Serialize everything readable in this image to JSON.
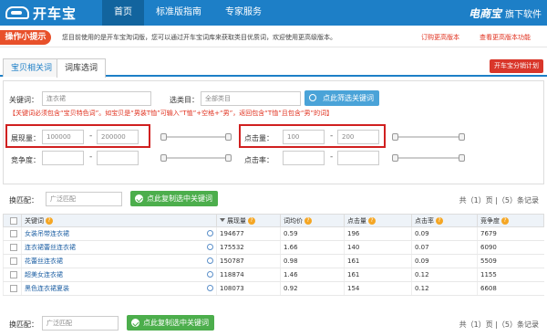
{
  "header": {
    "logo_text": "开车宝",
    "nav": [
      "首页",
      "标准版指南",
      "专家服务"
    ],
    "brand_name": "电商宝",
    "brand_suffix": "旗下软件"
  },
  "notice": {
    "badge": "操作小提示",
    "text": "您目前使用的是开车宝淘词版，您可以通过开车宝词库来获取类目优质词，欢迎使用更高级版本。",
    "link1": "订购更高版本",
    "link2": "查看更高版本功能"
  },
  "tabs": [
    "宝贝相关词",
    "词库选词"
  ],
  "plan_button": "开车宝分销计划",
  "filters": {
    "keyword_label": "关键词：",
    "keyword_value": "连衣裙",
    "category_label": "选类目：",
    "category_value": "全部类目",
    "search_button": "点此筛选关键词",
    "hint": "【关键词必须包含“宝贝特色词”。如宝贝是“男装T恤”可输入“T恤”+空格+“男”，返回包含“T恤”且包含“男”的词】",
    "impressions_label": "展现量：",
    "impressions_min": "100000",
    "impressions_max": "200000",
    "clicks_label": "点击量：",
    "clicks_min": "100",
    "clicks_max": "200",
    "competition_label": "竞争度：",
    "ctr_label": "点击率：",
    "dash": "-"
  },
  "match": {
    "label": "换匹配：",
    "value": "广泛匹配",
    "copy_button": "点此复制选中关键词",
    "pager": "共（1）页 |（5）条记录"
  },
  "table": {
    "columns": [
      "关键词",
      "展现量",
      "词均价",
      "点击量",
      "点击率",
      "竞争度"
    ],
    "rows": [
      [
        "女装吊带连衣裙",
        "194677",
        "0.59",
        "196",
        "0.09",
        "7679"
      ],
      [
        "连衣裙蕾丝连衣裙",
        "175532",
        "1.66",
        "140",
        "0.07",
        "6090"
      ],
      [
        "花蕾丝连衣裙",
        "150787",
        "0.98",
        "161",
        "0.09",
        "5509"
      ],
      [
        "超美女连衣裙",
        "118874",
        "1.46",
        "161",
        "0.12",
        "1155"
      ],
      [
        "黑色连衣裙夏装",
        "108073",
        "0.92",
        "154",
        "0.12",
        "6608"
      ]
    ]
  }
}
